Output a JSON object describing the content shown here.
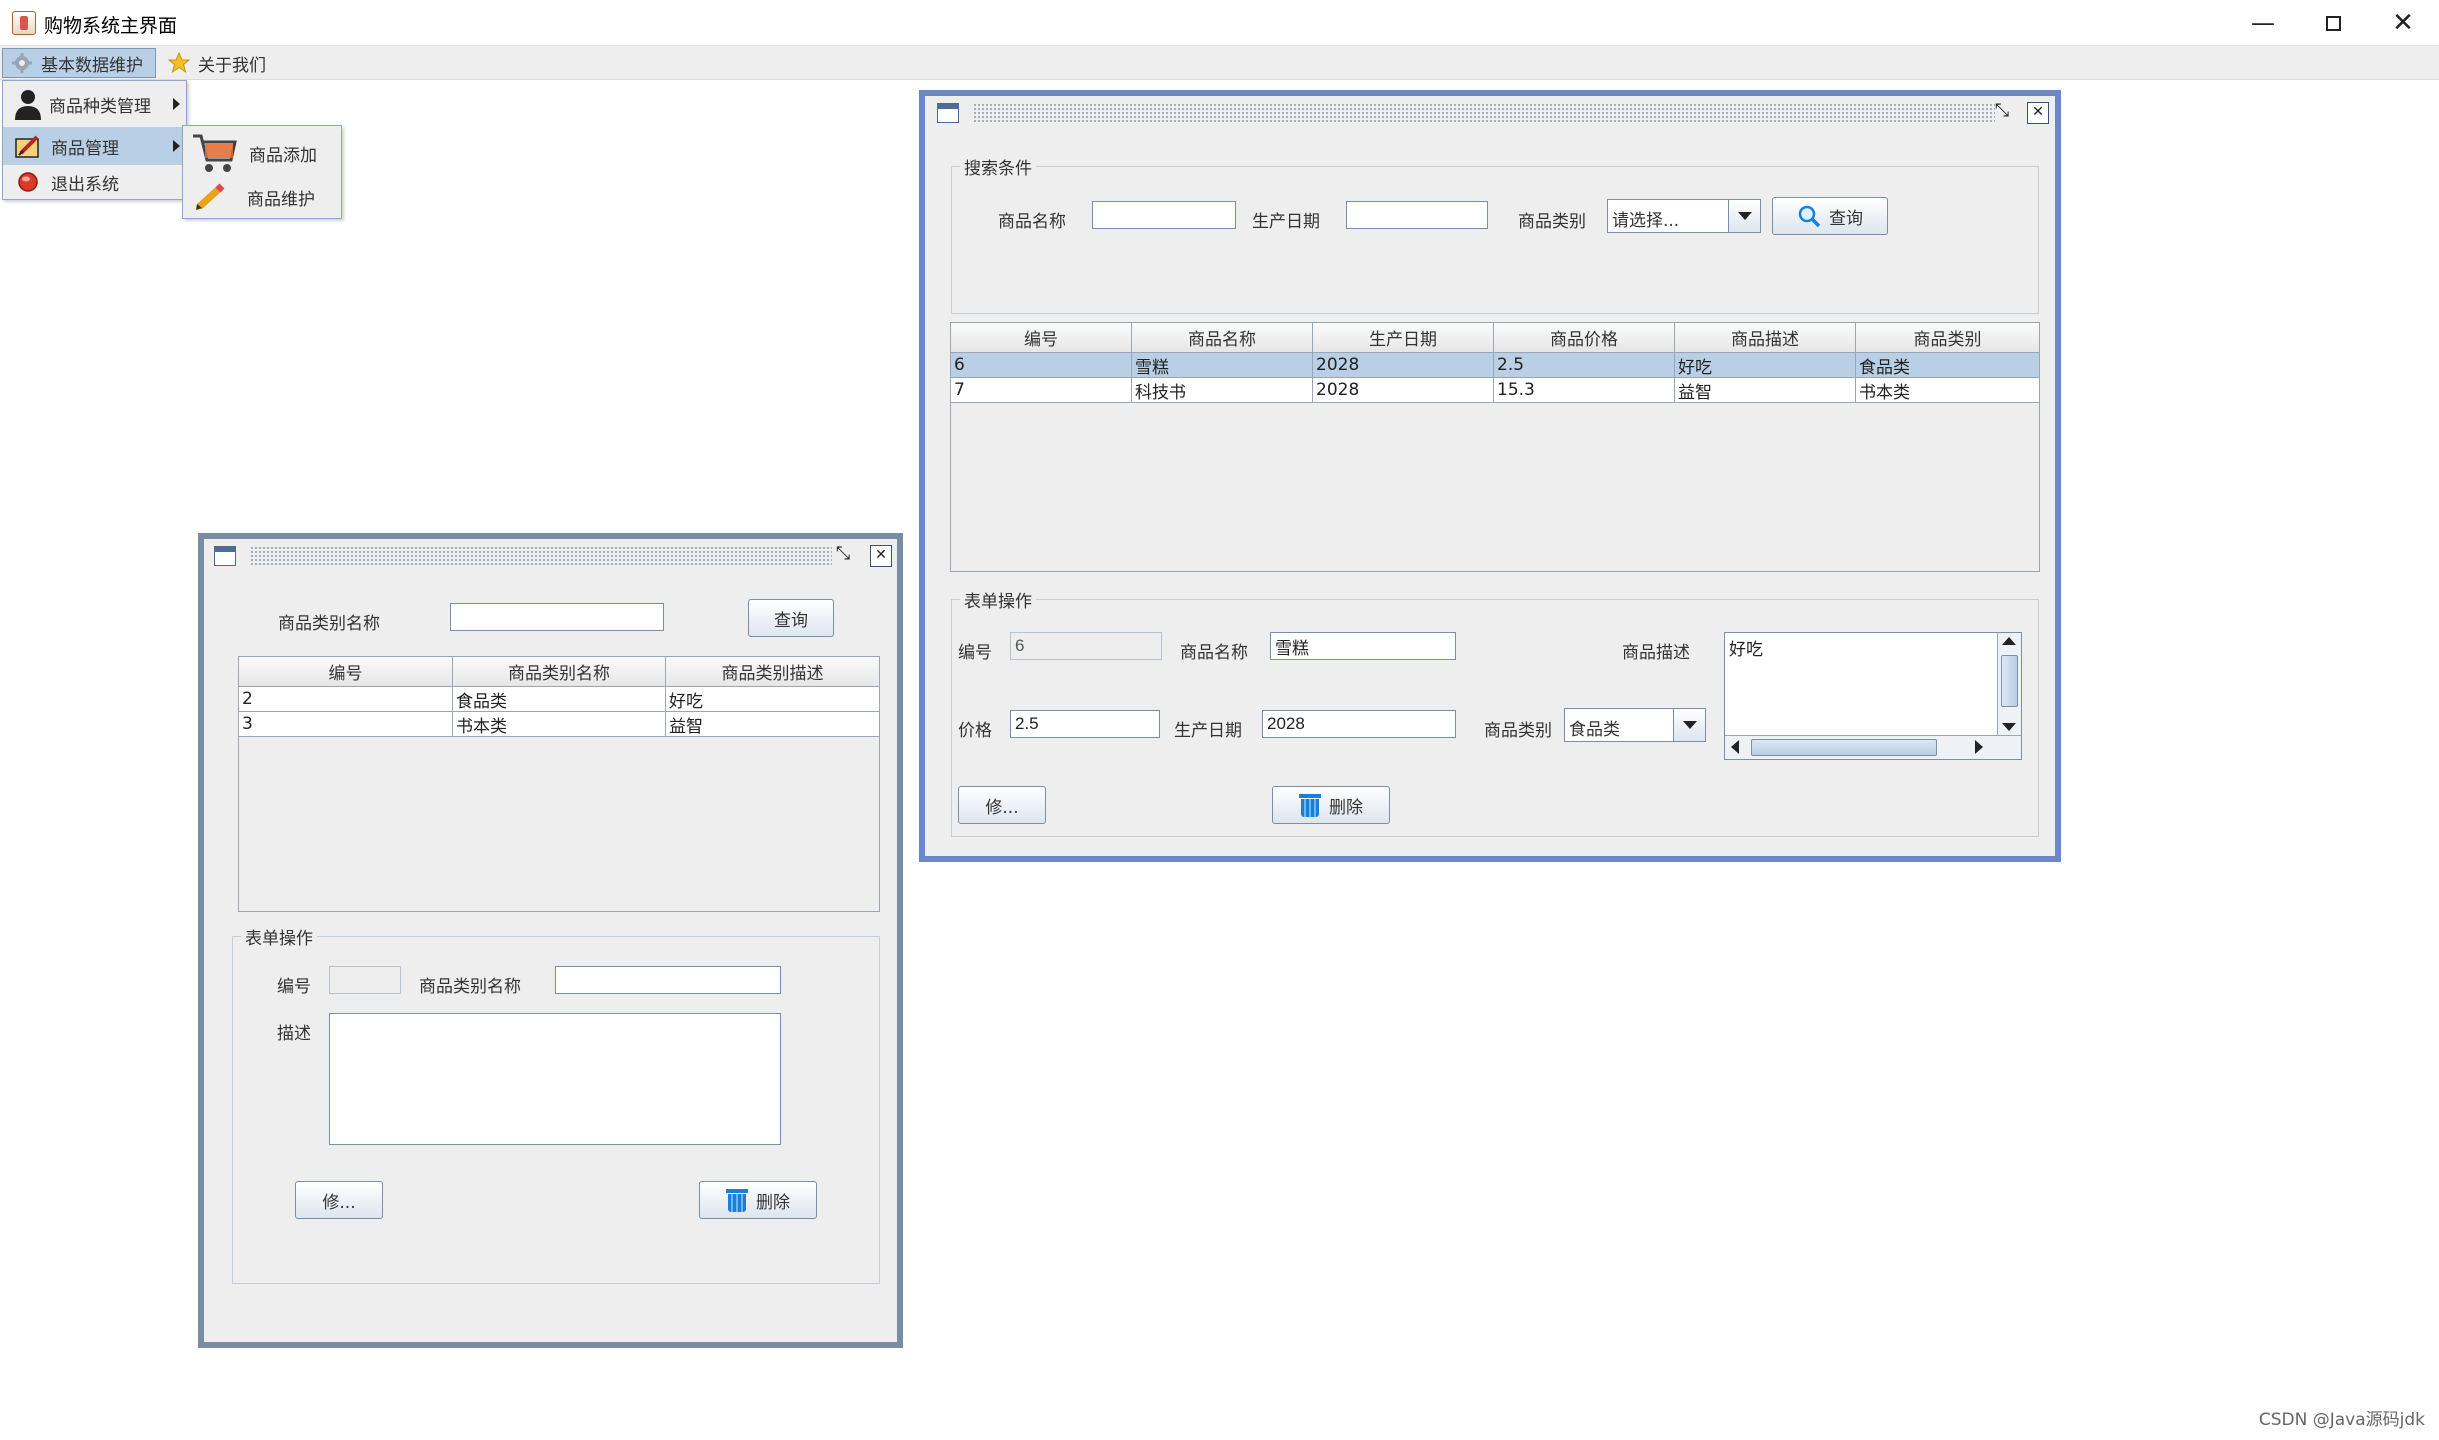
{
  "window": {
    "title": "购物系统主界面"
  },
  "menubar": {
    "items": [
      {
        "label": "基本数据维护",
        "icon": "gear-icon"
      },
      {
        "label": "关于我们",
        "icon": "star-icon"
      }
    ]
  },
  "main_menu": {
    "items": [
      {
        "label": "商品种类管理",
        "icon": "user-icon"
      },
      {
        "label": "商品管理",
        "icon": "edit-icon"
      },
      {
        "label": "退出系统",
        "icon": "exit-icon"
      }
    ]
  },
  "sub_menu": {
    "items": [
      {
        "label": "商品添加",
        "icon": "cart-icon"
      },
      {
        "label": "商品维护",
        "icon": "pencil-icon"
      }
    ]
  },
  "category_frame": {
    "search_label": "商品类别名称",
    "search_value": "",
    "query_button": "查询",
    "table": {
      "columns": [
        "编号",
        "商品类别名称",
        "商品类别描述"
      ],
      "rows": [
        [
          "2",
          "食品类",
          "好吃"
        ],
        [
          "3",
          "书本类",
          "益智"
        ]
      ]
    },
    "form": {
      "title": "表单操作",
      "id_label": "编号",
      "id_value": "",
      "name_label": "商品类别名称",
      "name_value": "",
      "desc_label": "描述",
      "desc_value": "",
      "modify_button": "修...",
      "delete_button": "删除"
    }
  },
  "product_frame": {
    "search": {
      "title": "搜索条件",
      "name_label": "商品名称",
      "name_value": "",
      "date_label": "生产日期",
      "date_value": "",
      "category_label": "商品类别",
      "category_value": "请选择...",
      "query_button": "查询"
    },
    "table": {
      "columns": [
        "编号",
        "商品名称",
        "生产日期",
        "商品价格",
        "商品描述",
        "商品类别"
      ],
      "rows": [
        [
          "6",
          "雪糕",
          "2028",
          "2.5",
          "好吃",
          "食品类"
        ],
        [
          "7",
          "科技书",
          "2028",
          "15.3",
          "益智",
          "书本类"
        ]
      ],
      "selected_row": 0
    },
    "form": {
      "title": "表单操作",
      "id_label": "编号",
      "id_value": "6",
      "name_label": "商品名称",
      "name_value": "雪糕",
      "desc_label": "商品描述",
      "desc_value": "好吃",
      "price_label": "价格",
      "price_value": "2.5",
      "date_label": "生产日期",
      "date_value": "2028",
      "category_label": "商品类别",
      "category_value": "食品类",
      "modify_button": "修...",
      "delete_button": "删除"
    }
  },
  "watermark": "CSDN @Java源码jdk"
}
